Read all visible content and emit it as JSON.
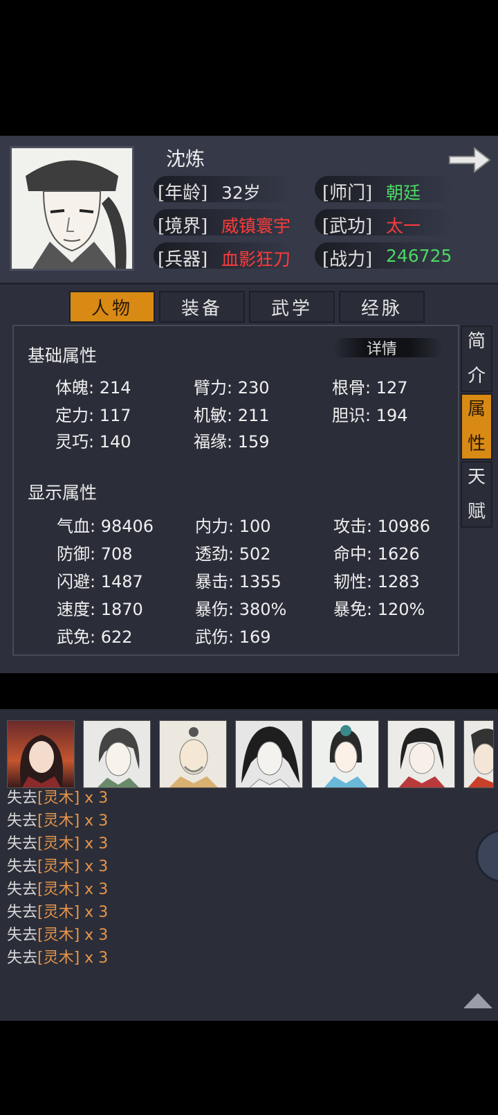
{
  "header": {
    "name": "沈炼",
    "rows": [
      {
        "l1": "[年龄]",
        "v1": "32岁",
        "l2": "[师门]",
        "v2": "朝廷"
      },
      {
        "l1": "[境界]",
        "v1": "威镇寰宇",
        "l2": "[武功]",
        "v2": "太一"
      },
      {
        "l1": "[兵器]",
        "v1": "血影狂刀",
        "l2": "[战力]",
        "v2": "246725"
      }
    ]
  },
  "tabs": [
    "人物",
    "装备",
    "武学",
    "经脉"
  ],
  "side_tabs": [
    {
      "c1": "简",
      "c2": "介"
    },
    {
      "c1": "属",
      "c2": "性"
    },
    {
      "c1": "天",
      "c2": "赋"
    }
  ],
  "detail_label": "详情",
  "basic": {
    "title": "基础属性",
    "stats": [
      "体魄: 214",
      "臂力: 230",
      "根骨: 127",
      "定力: 117",
      "机敏: 211",
      "胆识: 194",
      "灵巧: 140",
      "福缘: 159"
    ]
  },
  "display": {
    "title": "显示属性",
    "stats": [
      "气血: 98406",
      "内力: 100",
      "攻击: 10986",
      "防御: 708",
      "透劲: 502",
      "命中: 1626",
      "闪避: 1487",
      "暴击: 1355",
      "韧性: 1283",
      "速度: 1870",
      "暴伤: 380%",
      "暴免: 120%",
      "武免: 622",
      "武伤: 169"
    ]
  },
  "log": {
    "prefix": "失去",
    "item": "[灵木]",
    "suffix": " x 3",
    "count_lines": 8
  },
  "colors": {
    "accent": "#d98a14",
    "red": "#ff3b3b",
    "green": "#4cd964",
    "log_item": "#e8954a"
  }
}
